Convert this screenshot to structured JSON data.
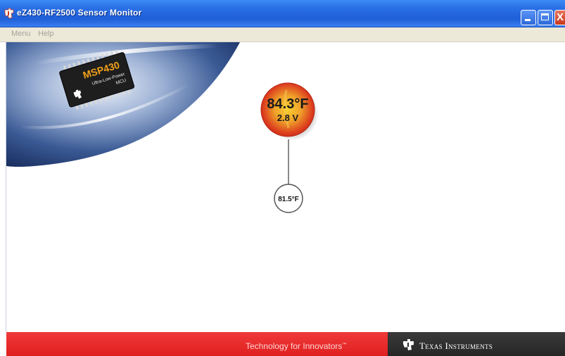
{
  "window": {
    "title": "eZ430-RF2500 Sensor Monitor",
    "controls": {
      "minimize_icon": "minimize-icon",
      "maximize_icon": "maximize-icon",
      "close_glyph": "X"
    }
  },
  "menu": {
    "items": [
      {
        "label": "Menu"
      },
      {
        "label": "Help"
      }
    ]
  },
  "banner": {
    "chip_label": "MSP430",
    "chip_subtitle_1": "Ultra-Low-Power",
    "chip_subtitle_2": "MCU"
  },
  "network": {
    "access_point": {
      "temperature": "84.3°F",
      "voltage": "2.8 V"
    },
    "end_devices": [
      {
        "temperature": "81.5°F"
      }
    ]
  },
  "footer": {
    "tagline": "Technology for Innovators",
    "tagline_mark": "™",
    "company": "Texas Instruments"
  },
  "colors": {
    "titlebar": "#2a6fe5",
    "footer_red": "#e01f1f",
    "footer_dark": "#2b2b2b",
    "hub_center": "#f6c02a",
    "hub_edge": "#d8321f"
  }
}
